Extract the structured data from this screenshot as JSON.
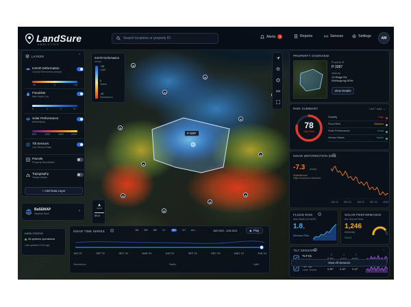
{
  "brand": {
    "name_part1": "Land",
    "name_part2": "Sure",
    "tagline": "ANALYTICS"
  },
  "search": {
    "placeholder": "Search locations or property ID"
  },
  "nav": {
    "alerts_label": "Alerts",
    "alerts_count": "3",
    "reports_label": "Reports",
    "sensors_label": "Sensors",
    "settings_label": "Settings",
    "avatar_initials": "AM"
  },
  "layers_panel": {
    "title": "LAYERS",
    "items": [
      {
        "name": "InSAR Deformation",
        "sub": "Ground Movement (mm/yr)",
        "on": true
      },
      {
        "name": "FloodSite",
        "sub": "Max Depth (m)",
        "on": true
      },
      {
        "name": "Solar Performance",
        "sub": "kWh/kWp/yr",
        "on": true
      },
      {
        "name": "Tilt Sensors",
        "sub": "Live Sensor Data",
        "on": true
      },
      {
        "name": "Parcels",
        "sub": "Property Boundaries",
        "on": false
      },
      {
        "name": "Topography",
        "sub": "Terrain Model",
        "on": false
      }
    ],
    "insar_scale": [
      "-10",
      "0",
      "+10"
    ],
    "flood_scale": [
      "0",
      "1",
      "2",
      "3+"
    ],
    "solar_scale": [
      "800",
      "1200",
      "1600",
      "2000"
    ],
    "add_label": "+ Add Data Layer"
  },
  "basemap": {
    "title": "BaSEMAP",
    "sub": "Satellite Dark"
  },
  "data_status": {
    "title": "DATA STATUS",
    "line1": "All systems operational",
    "line2": "Last updated: 5 min ago"
  },
  "legend": {
    "title": "InSAR Deformation",
    "sub": "mm/yr",
    "ticks": [
      "+10",
      "Uplift",
      "0",
      "Stable",
      "-10",
      "Subsidence"
    ]
  },
  "map": {
    "parcel_label": "P-3287",
    "scale_label": "50 m"
  },
  "timeline": {
    "title": "InSAR TIME SERIES",
    "ranges": [
      "1M",
      "3M",
      "6M",
      "1Y",
      "2Y",
      "5Y",
      "ALL"
    ],
    "date_range": "JUN 2022 - JUN 2024",
    "play_label": "Play",
    "ticks": [
      "JUN '22",
      "SEP '22",
      "DEC '22",
      "MAR '23",
      "JUN '23",
      "SEP '23",
      "DEC '23",
      "MAR '24",
      "JUN '24"
    ],
    "footer": [
      "Subsidence",
      "Stable",
      "Uplift"
    ]
  },
  "property": {
    "title": "PROPERTY OVERVIEW",
    "id_label": "Property ID",
    "id": "P-3287",
    "address_label": "Address",
    "address_line1": "12 Ridge Rd",
    "address_line2": "Wollongong NSW",
    "button": "View Details"
  },
  "risk": {
    "title": "RISK SUMMARY",
    "period": "Last 7 days",
    "score": "78",
    "score_label": "High Risk",
    "score_value": 0.78,
    "rows": [
      {
        "label": "Stability",
        "value": "High"
      },
      {
        "label": "Flood Risk",
        "value": "Medium"
      },
      {
        "label": "Solar Performance",
        "value": "Good"
      },
      {
        "label": "Sensor Status",
        "value": "Active"
      }
    ]
  },
  "insar": {
    "title": "InSAR DEFORMATION (mm)",
    "value": "-7.3",
    "unit": "mm/yr",
    "status": "Subsidence",
    "status_sub": "High movement detected",
    "x_ticks": [
      "JUN 22",
      "DEC 22",
      "JUN 23",
      "DEC 23",
      "NOW"
    ]
  },
  "flood": {
    "title": "FLOOD RISK",
    "sub": "Max depth (1% AEP)",
    "value": "1.8",
    "unit": "m",
    "level": "Medium Risk"
  },
  "solar": {
    "title": "SOLAR PERFORMANCE",
    "sub": "Est. Annual Yield",
    "value": "1,246",
    "unit": "kWh/kWp",
    "level": "Good"
  },
  "tilt": {
    "title": "TILT SENSORS",
    "sensors": [
      {
        "id": "TLT-01",
        "loc": "North Slope",
        "x": "0.29°",
        "y": "-0.11°",
        "z": "0.07°"
      },
      {
        "id": "TLT-02",
        "loc": "Lower Terrace",
        "x": "0.38°",
        "y": "0.19°",
        "z": "0.12°"
      }
    ],
    "axis_labels": [
      "X",
      "Y",
      "Z"
    ],
    "button": "View All Sensors"
  },
  "colors": {
    "accent": "#2b6fe0",
    "high": "#e0392f",
    "medium": "#f0a020",
    "good": "#2fbf6a",
    "solar": "#f2b21c",
    "purple": "#a45ae8"
  }
}
